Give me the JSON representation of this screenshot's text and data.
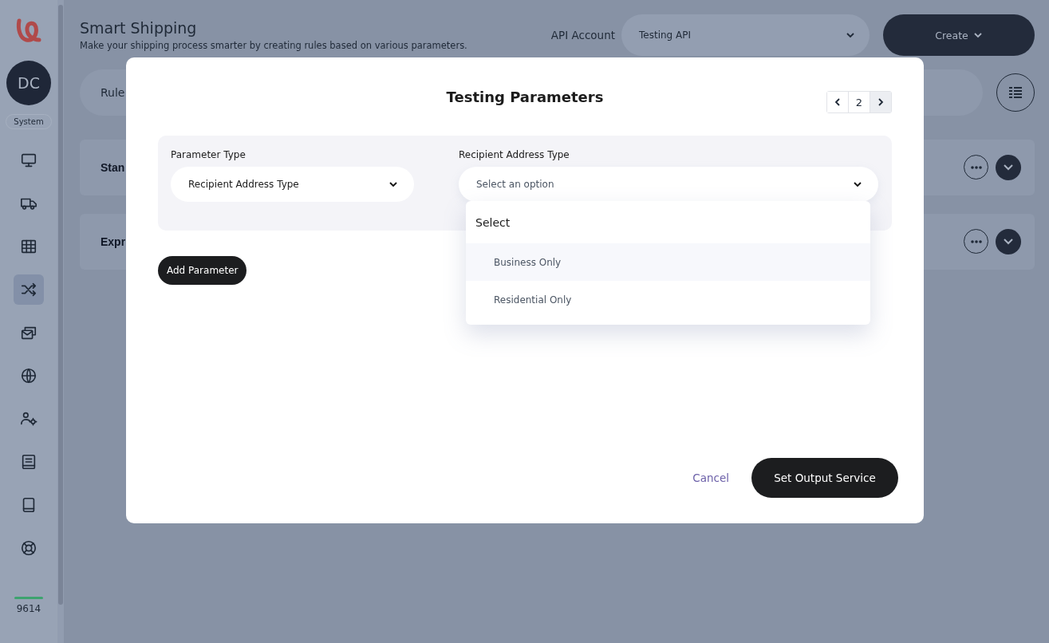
{
  "sidebar": {
    "avatar": "DC",
    "role": "System",
    "items": [
      {
        "selected": false
      },
      {
        "selected": false
      },
      {
        "selected": false
      },
      {
        "selected": true
      },
      {
        "selected": false
      },
      {
        "selected": false
      },
      {
        "selected": false
      },
      {
        "selected": false
      },
      {
        "selected": false
      },
      {
        "selected": false
      }
    ],
    "counter": "9614"
  },
  "header": {
    "title": "Smart Shipping",
    "subtitle": "Make your shipping process smarter by creating rules based on various parameters.",
    "api_account_label": "API Account",
    "api_account_value": "Testing API",
    "create_button": "Create"
  },
  "rule_bar": {
    "label": "Rule"
  },
  "rule_cards": [
    {
      "name": "Stan"
    },
    {
      "name": "Expr"
    }
  ],
  "modal": {
    "title": "Testing Parameters",
    "pager": {
      "page": "2"
    },
    "parameters": [
      {
        "label": "Parameter Type",
        "value": "Recipient Address Type",
        "expanded": false
      },
      {
        "label": "Recipient Address Type",
        "placeholder": "Select an option",
        "expanded": true
      }
    ],
    "dropdown": {
      "header": "Select",
      "options": [
        {
          "label": "Business Only",
          "selected": true
        },
        {
          "label": "Residential Only",
          "selected": false
        }
      ]
    },
    "add_button": "Add Parameter",
    "cancel_button": "Cancel",
    "submit_button": "Set Output Service"
  }
}
